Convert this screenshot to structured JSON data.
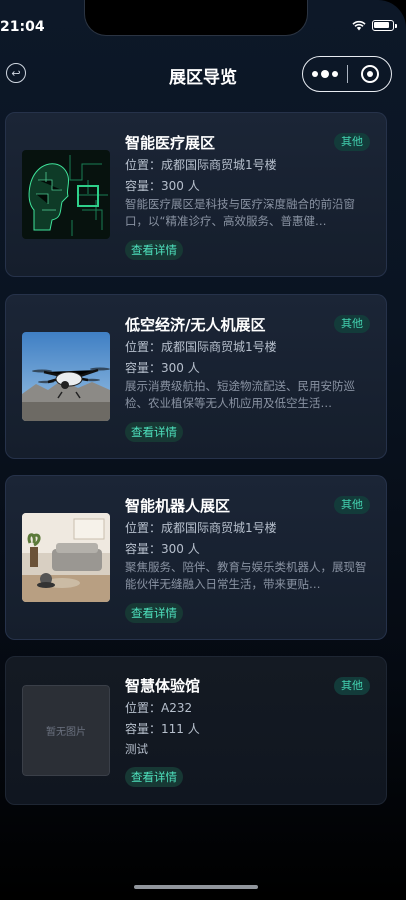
{
  "status_bar": {
    "time": "21:04"
  },
  "navbar": {
    "title": "展区导览"
  },
  "zones": [
    {
      "title": "智能医疗展区",
      "tag": "其他",
      "location": "位置：成都国际商贸城1号楼",
      "capacity": "容量：300 人",
      "description": "智能医疗展区是科技与医疗深度融合的前沿窗口，以“精准诊疗、高效服务、普惠健…",
      "detail_label": "查看详情",
      "image": "ai-medical-head"
    },
    {
      "title": "低空经济/无人机展区",
      "tag": "其他",
      "location": "位置：成都国际商贸城1号楼",
      "capacity": "容量：300 人",
      "description": "展示消费级航拍、短途物流配送、民用安防巡检、农业植保等无人机应用及低空生活…",
      "detail_label": "查看详情",
      "image": "drone-photo"
    },
    {
      "title": "智能机器人展区",
      "tag": "其他",
      "location": "位置：成都国际商贸城1号楼",
      "capacity": "容量：300 人",
      "description": "聚焦服务、陪伴、教育与娱乐类机器人，展现智能伙伴无缝融入日常生活，带来更贴…",
      "detail_label": "查看详情",
      "image": "living-room-robot"
    },
    {
      "title": "智慧体验馆",
      "tag": "其他",
      "location": "位置：A232",
      "capacity": "容量：111 人",
      "description": "测试",
      "detail_label": "查看详情",
      "no_image_text": "暂无图片"
    }
  ]
}
